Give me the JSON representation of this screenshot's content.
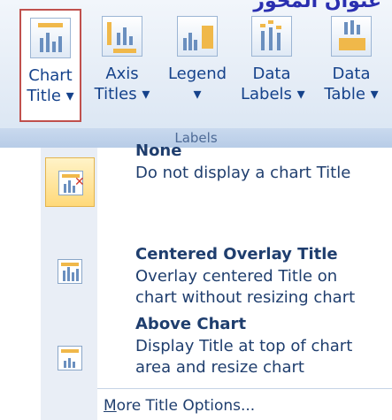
{
  "banner": "عنوان المحور",
  "ribbon": {
    "buttons": [
      {
        "line1": "Chart",
        "line2": "Title ▾",
        "icon": "chart-title-icon"
      },
      {
        "line1": "Axis",
        "line2": "Titles ▾",
        "icon": "axis-titles-icon"
      },
      {
        "line1": "Legend",
        "line2": "▾",
        "icon": "legend-icon"
      },
      {
        "line1": "Data",
        "line2": "Labels ▾",
        "icon": "data-labels-icon"
      },
      {
        "line1": "Data",
        "line2": "Table ▾",
        "icon": "data-table-icon"
      }
    ],
    "group_label": "Labels"
  },
  "menu": {
    "items": [
      {
        "title": "None",
        "desc1": "Do not display a chart Title",
        "desc2": "",
        "icon": "no-title-icon"
      },
      {
        "title": "Centered Overlay Title",
        "desc1": "Overlay centered Title on",
        "desc2": "chart without resizing chart",
        "icon": "centered-overlay-title-icon"
      },
      {
        "title": "Above Chart",
        "desc1": "Display Title at top of chart",
        "desc2": "area and resize chart",
        "icon": "above-chart-title-icon"
      }
    ],
    "more_prefix": "M",
    "more_rest": "ore Title Options..."
  },
  "colors": {
    "ribbon_bg": "#dfe9f5",
    "selected_bg": "#ffd97a",
    "active_border": "#c0504d",
    "text": "#15428b"
  }
}
